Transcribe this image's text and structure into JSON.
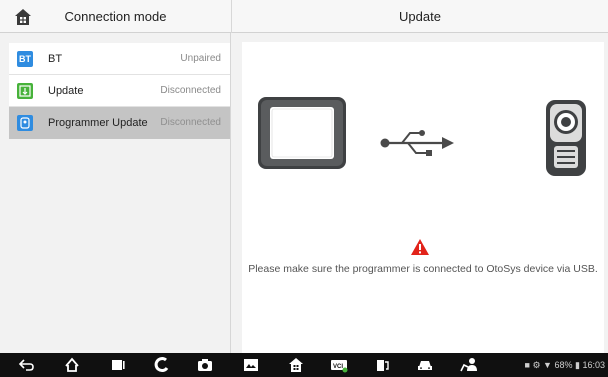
{
  "header": {
    "left_title": "Connection mode",
    "right_title": "Update"
  },
  "modes": [
    {
      "badge": "BT",
      "label": "BT",
      "status": "Unpaired",
      "icon": "bluetooth-icon"
    },
    {
      "badge": "",
      "label": "Update",
      "status": "Disconnected",
      "icon": "usb-update-icon"
    },
    {
      "badge": "",
      "label": "Programmer Update",
      "status": "Disconnected",
      "icon": "programmer-icon",
      "selected": true
    }
  ],
  "content": {
    "message": "Please make sure the programmer is connected to OtoSys device via USB.",
    "illustrations": [
      "tablet-icon",
      "usb-cable-icon",
      "programmer-device-icon",
      "warning-icon"
    ]
  },
  "navbar": {
    "buttons": [
      "back-icon",
      "home-icon",
      "recent-apps-icon",
      "browser-icon",
      "camera-icon",
      "screen-capture-icon",
      "autel-home-icon",
      "vci-icon",
      "service-icon",
      "car-icon",
      "remote-expert-icon"
    ],
    "status": "68%",
    "time": "16:03"
  },
  "colors": {
    "accent_blue": "#2f8ce0",
    "green": "#47b23a",
    "warning_red": "#e2231a",
    "selected_row": "#c4c4c4"
  }
}
